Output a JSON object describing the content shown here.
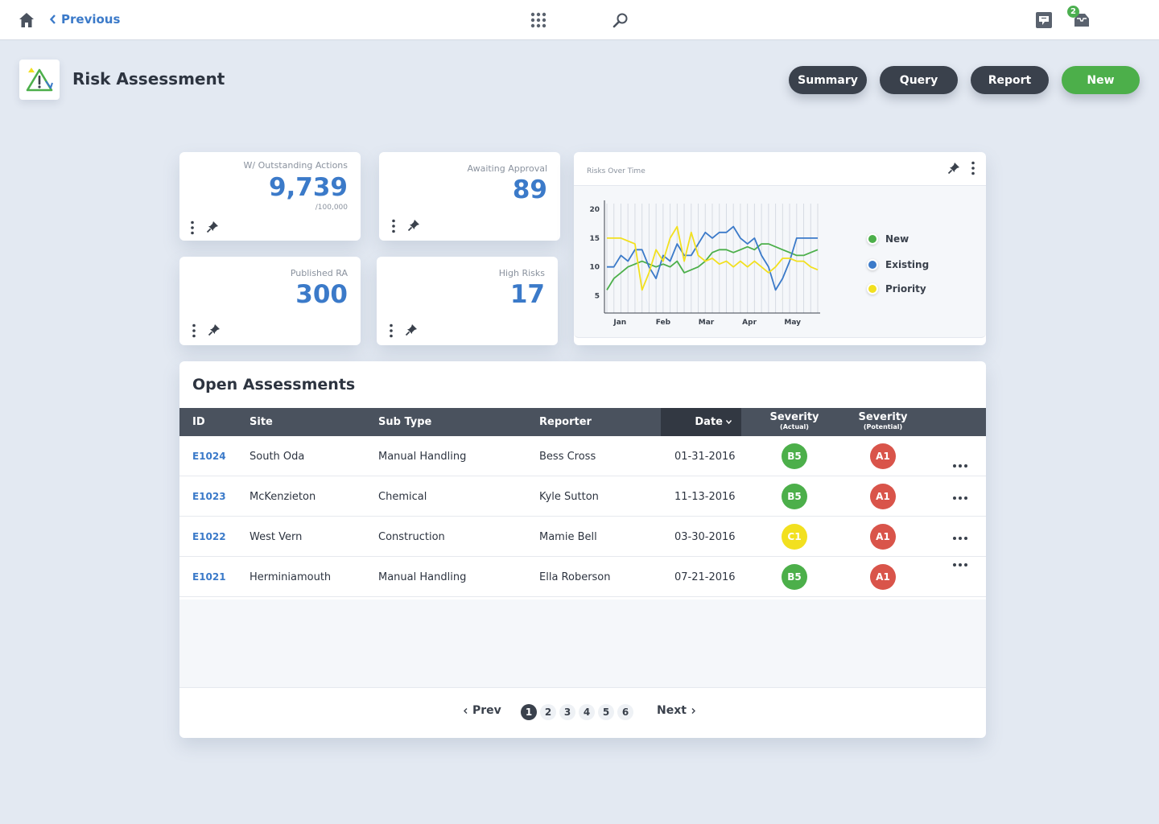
{
  "topbar": {
    "home_icon": "home-icon",
    "previous_label": "Previous",
    "notification_count": "2"
  },
  "header": {
    "title": "Risk Assessment",
    "buttons": {
      "summary": "Summary",
      "query": "Query",
      "report": "Report",
      "new": "New"
    }
  },
  "stats": [
    {
      "label": "W/ Outstanding Actions",
      "value": "9,739",
      "sub": "/100,000"
    },
    {
      "label": "Awaiting Approval",
      "value": "89",
      "sub": ""
    },
    {
      "label": "Published RA",
      "value": "300",
      "sub": ""
    },
    {
      "label": "High Risks",
      "value": "17",
      "sub": ""
    }
  ],
  "colors": {
    "accent_blue": "#3b7ac9",
    "green": "#4caf4a",
    "yellow": "#f2e01f",
    "red": "#d9544a",
    "dark": "#3a414c"
  },
  "chart_data": {
    "type": "line",
    "title": "Risks Over Time",
    "categories": [
      "Jan",
      "Feb",
      "Mar",
      "Apr",
      "May"
    ],
    "x_points": 31,
    "ylim": [
      2,
      21
    ],
    "yticks": [
      5,
      10,
      15,
      20
    ],
    "grid": "vertical",
    "legend": "right",
    "series": [
      {
        "name": "New",
        "color": "#4caf4a",
        "values": [
          6,
          8,
          9,
          10,
          10.5,
          11,
          10.5,
          10,
          10.5,
          10,
          11,
          9,
          9.5,
          10,
          11,
          12.5,
          13,
          13,
          12.5,
          13,
          13.5,
          13,
          14,
          14,
          13.5,
          13,
          12.5,
          12,
          12,
          12.5,
          13
        ]
      },
      {
        "name": "Existing",
        "color": "#3b7ac9",
        "values": [
          10,
          10,
          12,
          11,
          13,
          13,
          10,
          8,
          12,
          11,
          14,
          12,
          12,
          14,
          16,
          15,
          16,
          16,
          17,
          15,
          14,
          15,
          12,
          10,
          6,
          8,
          11,
          15,
          15,
          15,
          15
        ]
      },
      {
        "name": "Priority",
        "color": "#f2e01f",
        "values": [
          15,
          15,
          15,
          14.5,
          14,
          6,
          9,
          13,
          11,
          15,
          17,
          11,
          16,
          12,
          11,
          11.5,
          10.5,
          11,
          10,
          11,
          10,
          11,
          10,
          9,
          10,
          11.5,
          11.5,
          11,
          11,
          10,
          9.5
        ]
      }
    ]
  },
  "table": {
    "title": "Open Assessments",
    "headers": {
      "id": "ID",
      "site": "Site",
      "sub_type": "Sub Type",
      "reporter": "Reporter",
      "date": "Date",
      "sev_actual": "Severity",
      "sev_actual_sub": "(Actual)",
      "sev_potential": "Severity",
      "sev_potential_sub": "(Potential)"
    },
    "rows": [
      {
        "id": "E1024",
        "site": "South Oda",
        "sub_type": "Manual Handling",
        "reporter": "Bess Cross",
        "date": "01-31-2016",
        "actual": "B5",
        "actual_color": "#4caf4a",
        "potential": "A1",
        "potential_color": "#d9544a"
      },
      {
        "id": "E1023",
        "site": "McKenzieton",
        "sub_type": "Chemical",
        "reporter": "Kyle Sutton",
        "date": "11-13-2016",
        "actual": "B5",
        "actual_color": "#4caf4a",
        "potential": "A1",
        "potential_color": "#d9544a"
      },
      {
        "id": "E1022",
        "site": "West Vern",
        "sub_type": "Construction",
        "reporter": "Mamie Bell",
        "date": "03-30-2016",
        "actual": "C1",
        "actual_color": "#f2e01f",
        "potential": "A1",
        "potential_color": "#d9544a"
      },
      {
        "id": "E1021",
        "site": "Herminiamouth",
        "sub_type": "Manual Handling",
        "reporter": "Ella Roberson",
        "date": "07-21-2016",
        "actual": "B5",
        "actual_color": "#4caf4a",
        "potential": "A1",
        "potential_color": "#d9544a"
      }
    ]
  },
  "pagination": {
    "prev": "Prev",
    "next": "Next",
    "pages": [
      "1",
      "2",
      "3",
      "4",
      "5",
      "6"
    ],
    "current": "1"
  }
}
